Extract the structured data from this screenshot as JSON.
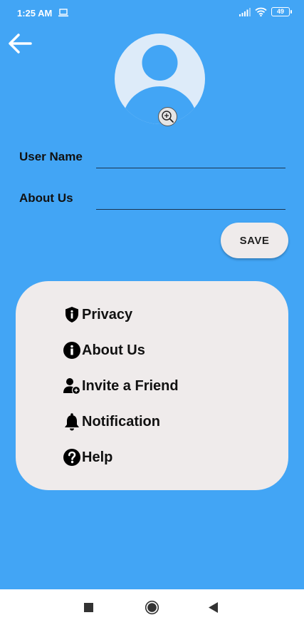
{
  "status_bar": {
    "time": "1:25 AM",
    "battery": "49"
  },
  "profile": {
    "user_name_label": "User Name",
    "user_name_value": "",
    "about_label": "About Us",
    "about_value": "",
    "save_label": "SAVE"
  },
  "menu": {
    "items": [
      {
        "label": "Privacy",
        "icon": "shield-info-icon"
      },
      {
        "label": "About Us",
        "icon": "info-icon"
      },
      {
        "label": "Invite a Friend",
        "icon": "add-user-icon"
      },
      {
        "label": "Notification",
        "icon": "bell-icon"
      },
      {
        "label": "Help",
        "icon": "help-icon"
      }
    ]
  },
  "colors": {
    "background": "#42A5F5",
    "card": "#EFEBEB",
    "avatar_bg": "#DDEBF9"
  }
}
